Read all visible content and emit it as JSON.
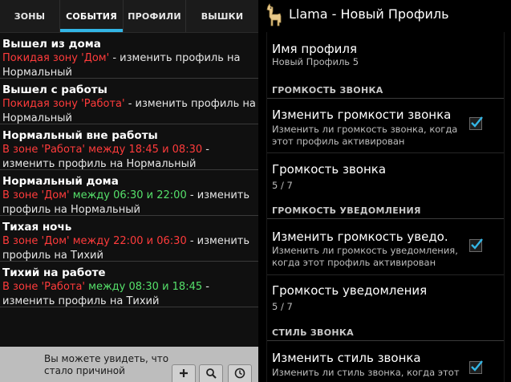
{
  "tabs": [
    {
      "label": "ЗОНЫ"
    },
    {
      "label": "СОБЫТИЯ"
    },
    {
      "label": "ПРОФИЛИ"
    },
    {
      "label": "ВЫШКИ"
    }
  ],
  "active_tab": "СОБЫТИЯ",
  "app": {
    "title": "Llama - Новый Профиль",
    "icon": "llama-icon"
  },
  "events": [
    {
      "title": "Вышел из дома",
      "desc": [
        {
          "t": "Покидая зону 'Дом'",
          "c": "red"
        },
        {
          "t": " - изменить профиль на Нормальный",
          "c": "white"
        }
      ]
    },
    {
      "title": "Вышел с работы",
      "desc": [
        {
          "t": "Покидая зону 'Работа'",
          "c": "red"
        },
        {
          "t": " - изменить профиль на Нормальный",
          "c": "white"
        }
      ]
    },
    {
      "title": "Нормальный вне работы",
      "desc": [
        {
          "t": "В зоне 'Работа' между 18:45 и 08:30",
          "c": "red"
        },
        {
          "t": " - изменить профиль на Нормальный",
          "c": "white"
        }
      ]
    },
    {
      "title": "Нормальный дома",
      "desc": [
        {
          "t": "В зоне 'Дом'",
          "c": "red"
        },
        {
          "t": " между 06:30 и 22:00",
          "c": "green"
        },
        {
          "t": " - изменить профиль на Нормальный",
          "c": "white"
        }
      ]
    },
    {
      "title": "Тихая ночь",
      "desc": [
        {
          "t": "В зоне 'Дом' между 22:00 и 06:30",
          "c": "red"
        },
        {
          "t": " - изменить профиль на Тихий",
          "c": "white"
        }
      ]
    },
    {
      "title": "Тихий на работе",
      "desc": [
        {
          "t": "В зоне 'Работа'",
          "c": "red"
        },
        {
          "t": " между 08:30 и 18:45",
          "c": "green"
        },
        {
          "t": " - изменить профиль на Тихий",
          "c": "white"
        }
      ]
    }
  ],
  "bottom": {
    "hint": "Вы можете увидеть, что стало причиной",
    "buttons": [
      "add-icon",
      "search-icon",
      "history-icon"
    ]
  },
  "profile": {
    "name_title": "Имя профиля",
    "name_value": "Новый Профиль 5",
    "sections": [
      {
        "header": "ГРОМКОСТЬ ЗВОНКА",
        "items": [
          {
            "title": "Изменить громкости звонка",
            "summary": "Изменить ли громкость звонка, когда этот профиль активирован",
            "checked": true
          },
          {
            "title": "Громкость звонка",
            "summary": "5 / 7"
          }
        ]
      },
      {
        "header": "ГРОМКОСТЬ УВЕДОМЛЕНИЯ",
        "items": [
          {
            "title": "Изменить громкость уведо.",
            "summary": "Изменить ли громкость уведомления, когда этот профиль активирован",
            "checked": true
          },
          {
            "title": "Громкость уведомления",
            "summary": "5 / 7"
          }
        ]
      },
      {
        "header": "СТИЛЬ ЗВОНКА",
        "items": [
          {
            "title": "Изменить стиль звонка",
            "summary": "Изменить ли стиль звонка, когда этот",
            "checked": true
          }
        ]
      }
    ]
  },
  "colors": {
    "accent": "#33b5e5",
    "red": "#ff3b3b",
    "green": "#55e06a"
  }
}
